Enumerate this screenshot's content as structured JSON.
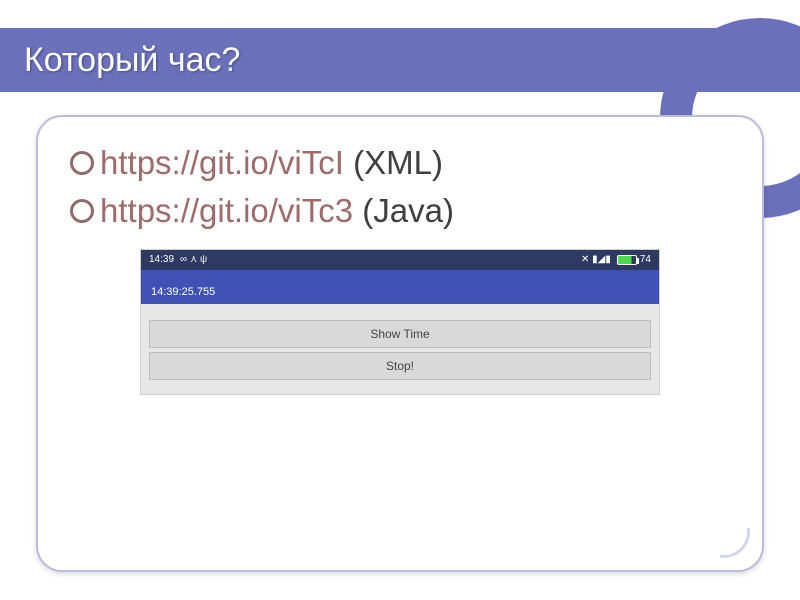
{
  "title": "Который час?",
  "bullets": [
    {
      "link": "https://git.io/viTcI",
      "tag": " (XML)"
    },
    {
      "link": "https://git.io/viTc3",
      "tag": " (Java)"
    }
  ],
  "screenshot": {
    "status_time": "14:39",
    "status_glyphs": "∞  ⋏  ψ",
    "status_right_glyphs": "✕  ▮◢▮",
    "battery": "74",
    "appbar_time": "14:39:25.755",
    "btn_show": "Show Time",
    "btn_stop": "Stop!"
  }
}
